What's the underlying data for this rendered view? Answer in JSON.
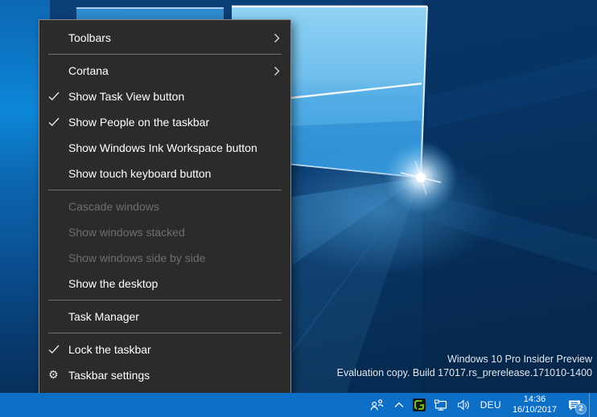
{
  "desktop": {
    "watermark": {
      "line1": "Windows 10 Pro Insider Preview",
      "line2": "Evaluation copy. Build 17017.rs_prerelease.171010-1400"
    }
  },
  "context_menu": {
    "items": [
      {
        "label": "Toolbars",
        "has_submenu": true,
        "checked": false,
        "disabled": false
      },
      {
        "label": "Cortana",
        "has_submenu": true,
        "checked": false,
        "disabled": false
      },
      {
        "label": "Show Task View button",
        "has_submenu": false,
        "checked": true,
        "disabled": false
      },
      {
        "label": "Show People on the taskbar",
        "has_submenu": false,
        "checked": true,
        "disabled": false
      },
      {
        "label": "Show Windows Ink Workspace button",
        "has_submenu": false,
        "checked": false,
        "disabled": false
      },
      {
        "label": "Show touch keyboard button",
        "has_submenu": false,
        "checked": false,
        "disabled": false
      },
      {
        "label": "Cascade windows",
        "has_submenu": false,
        "checked": false,
        "disabled": true
      },
      {
        "label": "Show windows stacked",
        "has_submenu": false,
        "checked": false,
        "disabled": true
      },
      {
        "label": "Show windows side by side",
        "has_submenu": false,
        "checked": false,
        "disabled": true
      },
      {
        "label": "Show the desktop",
        "has_submenu": false,
        "checked": false,
        "disabled": false
      },
      {
        "label": "Task Manager",
        "has_submenu": false,
        "checked": false,
        "disabled": false
      },
      {
        "label": "Lock the taskbar",
        "has_submenu": false,
        "checked": true,
        "disabled": false
      },
      {
        "label": "Taskbar settings",
        "has_submenu": false,
        "checked": false,
        "disabled": false,
        "icon": "gear-icon"
      }
    ]
  },
  "taskbar": {
    "tray": {
      "icons": [
        "people-icon",
        "chevron-up-icon",
        "greenshot-tray-icon",
        "network-icon",
        "volume-icon",
        "action-center-icon"
      ],
      "language": "DEU",
      "time": "14:36",
      "date": "16/10/2017",
      "notification_badge": "2"
    }
  },
  "colors": {
    "taskbar_blue": "#0c6ec4",
    "menu_background": "#2b2b2b",
    "menu_border": "#8a8a8a",
    "menu_text": "#ffffff",
    "menu_disabled_text": "#6e6e6e",
    "separator_gray": "#6f6f6f",
    "badge_blue": "#4795dc",
    "greenshot_green": "#7ad410"
  }
}
